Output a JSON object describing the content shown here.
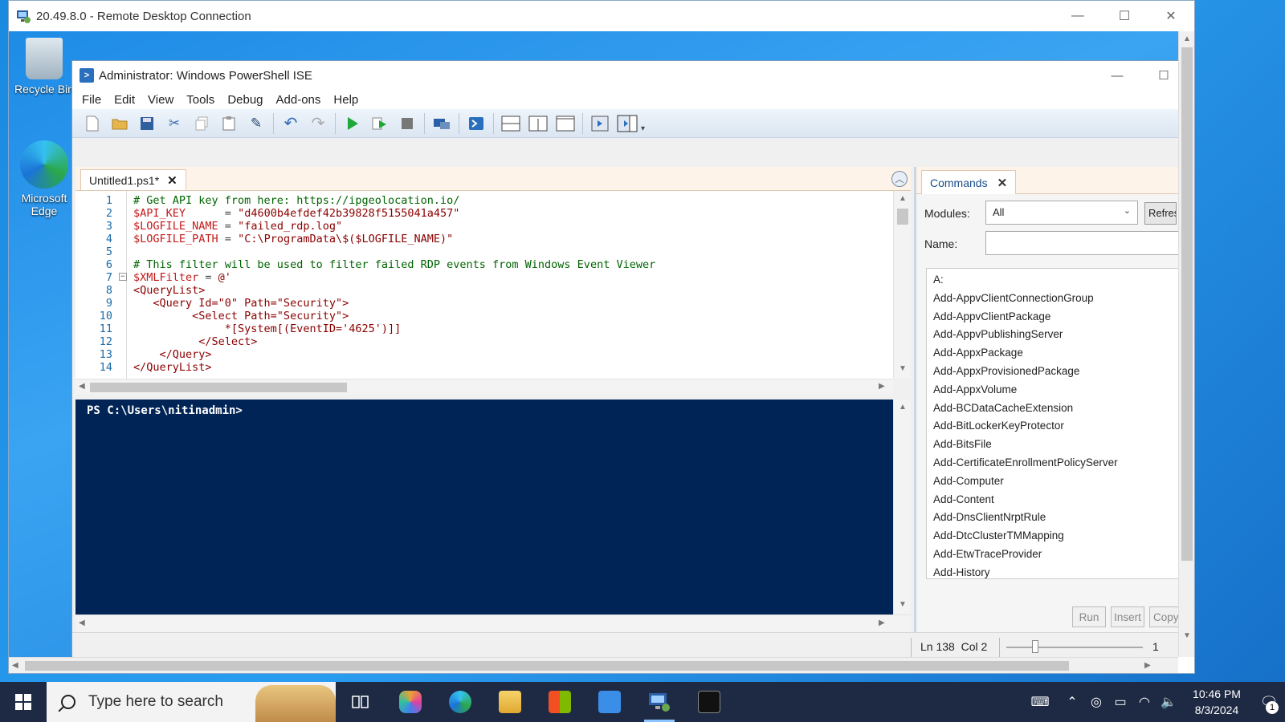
{
  "rdp": {
    "title": "20.49.8.0 - Remote Desktop Connection",
    "minimize": "—",
    "maximize": "☐",
    "close": "✕"
  },
  "desktop_icons": {
    "recycle_bin": "Recycle Bin",
    "edge": "Microsoft Edge"
  },
  "ise": {
    "title": "Administrator: Windows PowerShell ISE",
    "minimize": "—",
    "maximize": "☐",
    "menu": [
      "File",
      "Edit",
      "View",
      "Tools",
      "Debug",
      "Add-ons",
      "Help"
    ],
    "script_tab": "Untitled1.ps1*",
    "code_lines": [
      {
        "n": "1",
        "text": "# Get API key from here: https://ipgeolocation.io/",
        "kind": "comment"
      },
      {
        "n": "2",
        "var": "$API_KEY",
        "mid": "      = ",
        "str": "\"d4600b4efdef42b39828f5155041a457\""
      },
      {
        "n": "3",
        "var": "$LOGFILE_NAME",
        "mid": " = ",
        "str": "\"failed_rdp.log\""
      },
      {
        "n": "4",
        "var": "$LOGFILE_PATH",
        "mid": " = ",
        "str": "\"C:\\ProgramData\\$($LOGFILE_NAME)\""
      },
      {
        "n": "5",
        "text": "",
        "kind": "plain"
      },
      {
        "n": "6",
        "text": "# This filter will be used to filter failed RDP events from Windows Event Viewer",
        "kind": "comment"
      },
      {
        "n": "7",
        "var": "$XMLFilter",
        "mid": " = ",
        "str": "@'"
      },
      {
        "n": "8",
        "text": "<QueryList>",
        "kind": "tag"
      },
      {
        "n": "9",
        "text": "   <Query Id=\"0\" Path=\"Security\">",
        "kind": "tag"
      },
      {
        "n": "10",
        "text": "         <Select Path=\"Security\">",
        "kind": "tag"
      },
      {
        "n": "11",
        "text": "              *[System[(EventID='4625')]]",
        "kind": "tag"
      },
      {
        "n": "12",
        "text": "          </Select>",
        "kind": "tag"
      },
      {
        "n": "13",
        "text": "    </Query>",
        "kind": "tag"
      },
      {
        "n": "14",
        "text": "</QueryList>",
        "kind": "tag"
      }
    ],
    "console_prompt": "PS C:\\Users\\nitinadmin>",
    "status": {
      "line": "Ln 138",
      "col": "Col 2",
      "zoom": "1"
    }
  },
  "commands": {
    "tab_label": "Commands",
    "modules_label": "Modules:",
    "modules_value": "All",
    "refresh_label": "Refresh",
    "name_label": "Name:",
    "name_value": "",
    "items": [
      "A:",
      "Add-AppvClientConnectionGroup",
      "Add-AppvClientPackage",
      "Add-AppvPublishingServer",
      "Add-AppxPackage",
      "Add-AppxProvisionedPackage",
      "Add-AppxVolume",
      "Add-BCDataCacheExtension",
      "Add-BitLockerKeyProtector",
      "Add-BitsFile",
      "Add-CertificateEnrollmentPolicyServer",
      "Add-Computer",
      "Add-Content",
      "Add-DnsClientNrptRule",
      "Add-DtcClusterTMMapping",
      "Add-EtwTraceProvider",
      "Add-History"
    ],
    "run_label": "Run",
    "insert_label": "Insert",
    "copy_label": "Copy"
  },
  "taskbar": {
    "search_placeholder": "Type here to search",
    "time": "10:46 PM",
    "date": "8/3/2024",
    "notification_count": "1"
  }
}
